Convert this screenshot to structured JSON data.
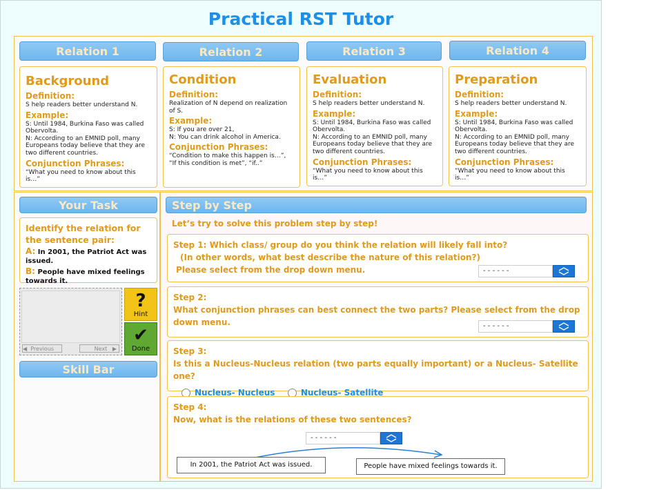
{
  "app_title": "Practical RST Tutor",
  "relations": [
    {
      "tab_label": "Relation 1",
      "name": "Background",
      "definition_label": "Definition:",
      "definition": "S help readers better understand N.",
      "example_label": "Example:",
      "example_s": "S:  Until 1984, Burkina Faso was called Obervolta.",
      "example_n": "N: According to an EMNID poll, many Europeans today believe that they are two different countries.",
      "conj_label": "Conjunction Phrases:",
      "conj": "“What you need to know about this is…”"
    },
    {
      "tab_label": "Relation 2",
      "name": "Condition",
      "definition_label": "Definition:",
      "definition": "Realization of N depend on realization of S.",
      "example_label": "Example:",
      "example_s": "S:  If you are over 21,",
      "example_n": "N: You can drink alcohol in America.",
      "conj_label": "Conjunction Phrases:",
      "conj": "“Condition to make this happen is…”, “If this condition is met”, “if..”"
    },
    {
      "tab_label": "Relation 3",
      "name": "Evaluation",
      "definition_label": "Definition:",
      "definition": "S help readers better understand N.",
      "example_label": "Example:",
      "example_s": "S:  Until 1984, Burkina Faso was called Obervolta.",
      "example_n": "N: According to an EMNID poll, many Europeans today believe that they are two different countries.",
      "conj_label": "Conjunction Phrases:",
      "conj": "“What you need to know about this is…”"
    },
    {
      "tab_label": "Relation 4",
      "name": "Preparation",
      "definition_label": "Definition:",
      "definition": "S help readers better understand N.",
      "example_label": "Example:",
      "example_s": "S:  Until 1984, Burkina Faso was called Obervolta.",
      "example_n": "N: According to an EMNID poll, many Europeans today believe that they are two different countries.",
      "conj_label": "Conjunction Phrases:",
      "conj": "“What you need to know about this is…”"
    }
  ],
  "task": {
    "header": "Your Task",
    "prompt": "Identify the relation for the sentence pair:",
    "a_label": "A:",
    "a_text": "In 2001, the Patriot Act was issued.",
    "b_label": "B:",
    "b_text": "People have mixed feelings towards it."
  },
  "nav": {
    "previous": "Previous",
    "next": "Next"
  },
  "hint": {
    "icon": "?",
    "label": "Hint"
  },
  "done": {
    "icon": "✔",
    "label": "Done"
  },
  "skill_bar": "Skill Bar",
  "steps": {
    "header": "Step by Step",
    "intro": "Let’s try to solve this problem step by step!",
    "s1_line1": "Step 1: Which class/ group do you think the relation will likely fall into?",
    "s1_line2": "(In other words, what best describe the nature of this relation?)",
    "s1_line3": "Please select from the drop down menu.",
    "s2_title": "Step 2:",
    "s2_text": "What conjunction phrases can best connect the two parts? Please select from the drop down menu.",
    "s3_title": "Step 3:",
    "s3_text": "Is this a Nucleus-Nucleus relation (two parts equally important) or a Nucleus- Satellite one?",
    "opt_nn": "Nucleus- Nucleus",
    "opt_ns": "Nucleus- Satellite",
    "s4_title": "Step 4:",
    "s4_text": "Now, what is the relations of these two sentences?",
    "select_value": "- - - - - -",
    "sent_a": "In 2001, the Patriot Act was issued.",
    "sent_b": "People have mixed feelings towards it."
  },
  "colors": {
    "accent_blue": "#1d8fe6",
    "orange": "#e29a1b",
    "hint_yellow": "#f2c418",
    "done_green": "#5fa832"
  }
}
